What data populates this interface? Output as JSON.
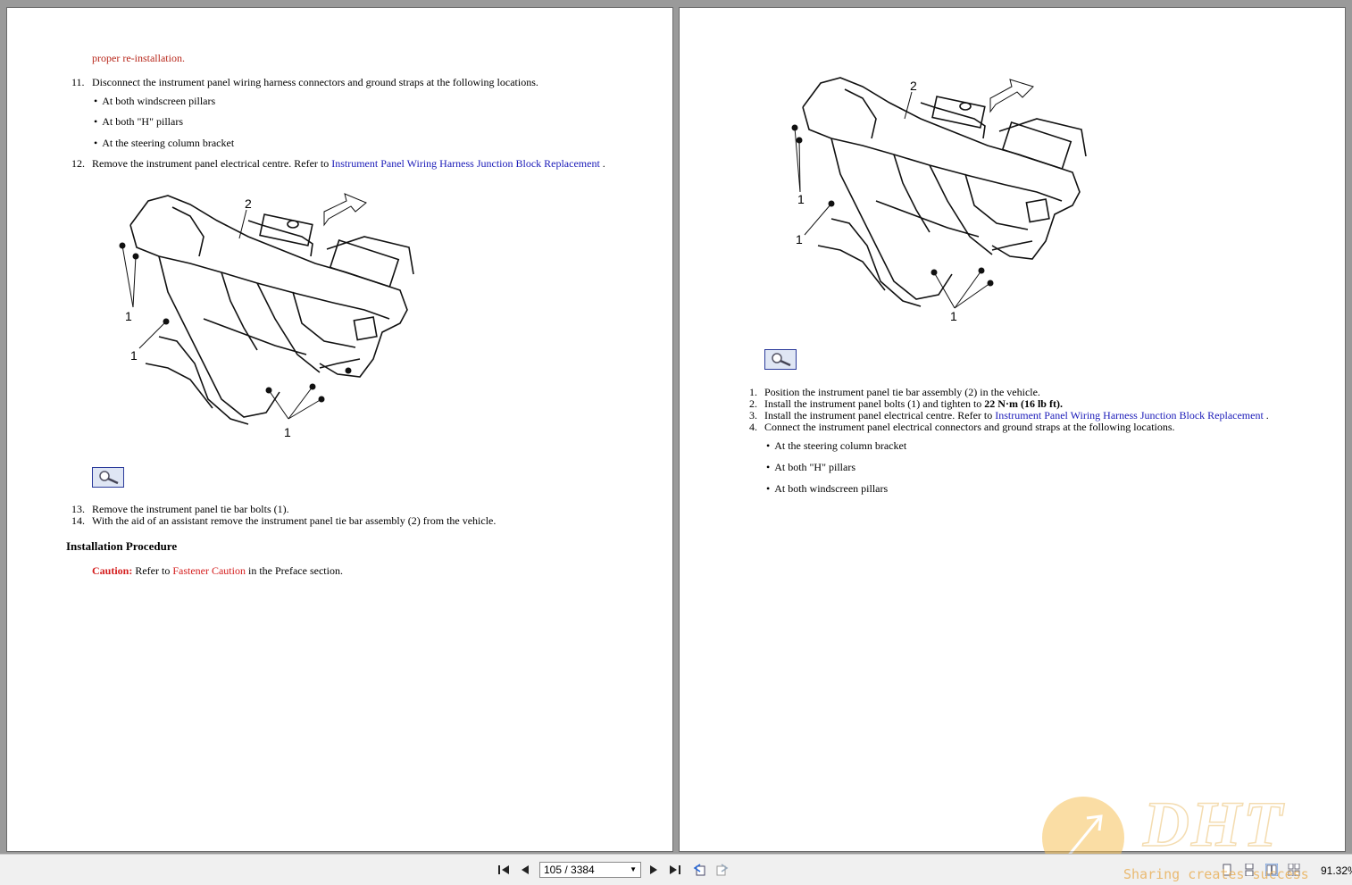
{
  "left_page": {
    "cont_line": "proper re-installation.",
    "step11": {
      "num": "11.",
      "text": "Disconnect the instrument panel wiring harness connectors and ground straps at the following locations."
    },
    "step11_bullets": [
      "At both windscreen pillars",
      "At both \"H\" pillars",
      "At the steering column bracket"
    ],
    "step12": {
      "num": "12.",
      "text": "Remove the instrument panel electrical centre. Refer to ",
      "link": "Instrument Panel Wiring Harness Junction Block Replacement",
      "end": " ."
    },
    "figure_callouts": {
      "one": "1",
      "two": "2"
    },
    "step13": {
      "num": "13.",
      "text": "Remove the instrument panel tie bar bolts (1)."
    },
    "step14": {
      "num": "14.",
      "text": "With the aid of an assistant remove the instrument panel tie bar assembly (2) from the vehicle."
    },
    "install_heading": "Installation Procedure",
    "caution_label": "Caution:",
    "caution_text": " Refer to ",
    "caution_link": "Fastener Caution",
    "caution_end": " in the Preface section."
  },
  "right_page": {
    "figure_callouts": {
      "one": "1",
      "two": "2"
    },
    "step1": {
      "num": "1.",
      "text": "Position the instrument panel tie bar assembly (2) in the vehicle."
    },
    "step2": {
      "num": "2.",
      "text": "Install the instrument panel bolts (1) and tighten to ",
      "torque": "22 N·m (16 lb ft)."
    },
    "step3": {
      "num": "3.",
      "text": "Install the instrument panel electrical centre. Refer to ",
      "link": "Instrument Panel Wiring Harness Junction Block Replacement",
      "end": " ."
    },
    "step4": {
      "num": "4.",
      "text": "Connect the instrument panel electrical connectors and ground straps at the following locations."
    },
    "step4_bullets": [
      "At the steering column bracket",
      "At both \"H\" pillars",
      "At both windscreen pillars"
    ]
  },
  "statusbar": {
    "page_indicator": "105 / 3384",
    "zoom": "91.32%"
  },
  "watermark": {
    "logo_text": "DHT",
    "tagline": "Sharing creates success"
  },
  "colors": {
    "link": "#1a1ab8",
    "caution": "#d41c1c",
    "cont": "#b8281c"
  }
}
